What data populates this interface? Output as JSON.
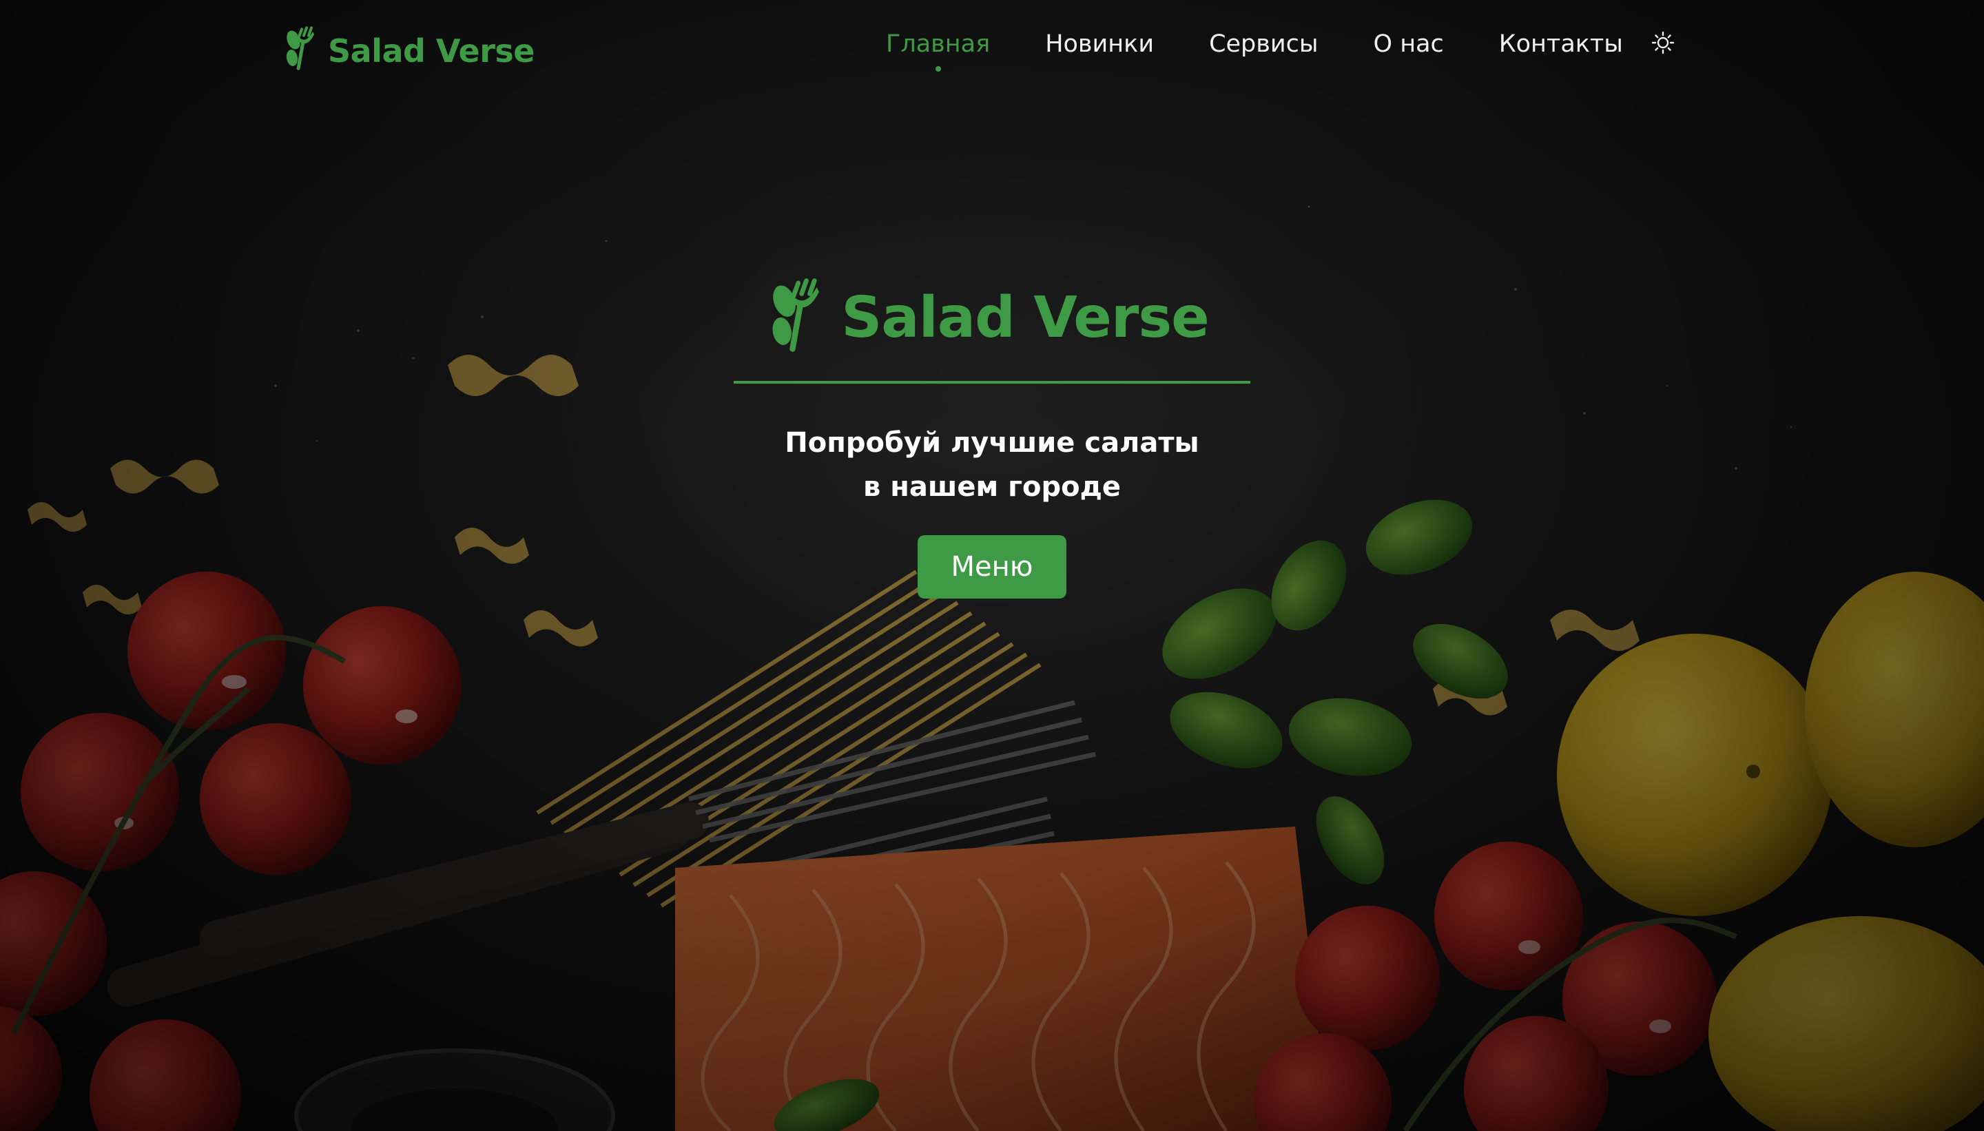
{
  "colors": {
    "accent": "#3f9a45",
    "nav_text": "#f1f1f1",
    "background": "#0e0e0e"
  },
  "header": {
    "brand": {
      "icon": "fork-leaf-icon",
      "name": "Salad Verse"
    },
    "nav": [
      {
        "label": "Главная",
        "active": true
      },
      {
        "label": "Новинки",
        "active": false
      },
      {
        "label": "Сервисы",
        "active": false
      },
      {
        "label": "О нас",
        "active": false
      },
      {
        "label": "Контакты",
        "active": false
      }
    ],
    "theme_toggle_icon": "sun-icon"
  },
  "hero": {
    "brand": {
      "icon": "fork-leaf-icon",
      "name": "Salad Verse"
    },
    "tagline_line1": "Попробуй лучшие салаты",
    "tagline_line2": "в нашем городе",
    "button_label": "Меню"
  },
  "background": {
    "subject": "food-background-image"
  }
}
